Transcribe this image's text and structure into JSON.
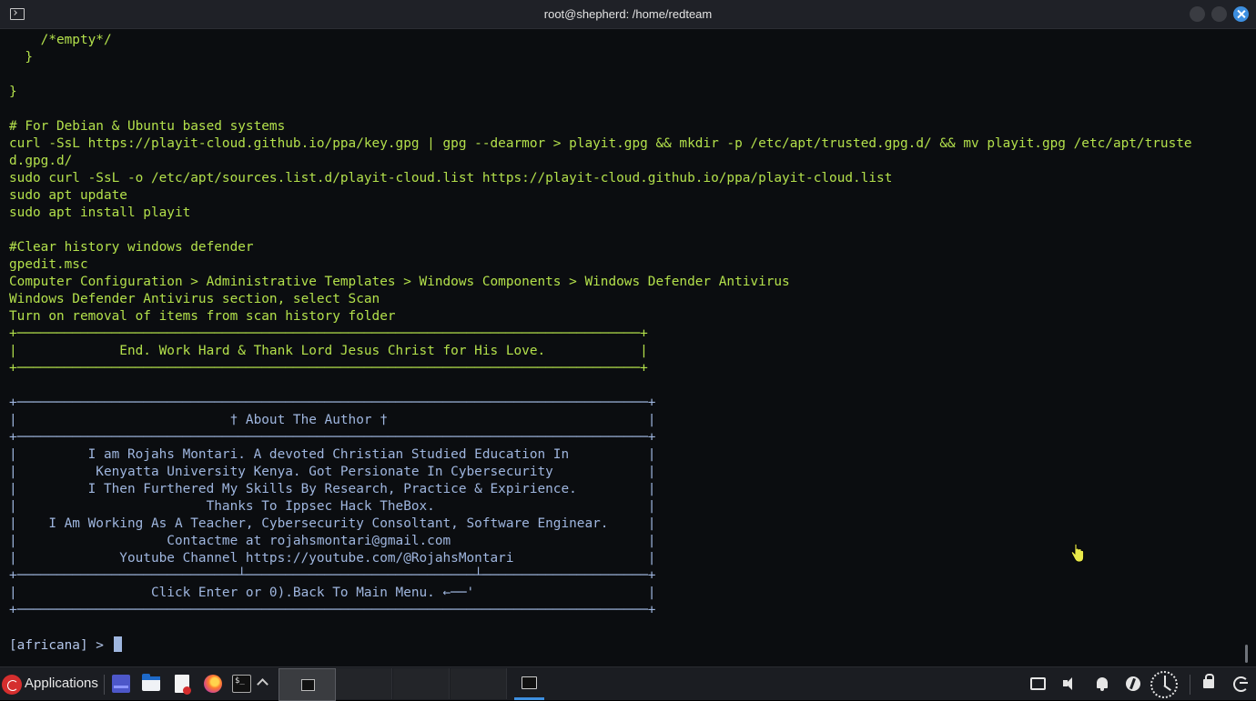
{
  "window": {
    "title": "root@shepherd: /home/redteam"
  },
  "terminal": {
    "lines": [
      {
        "text": "    /*empty*/",
        "color": "green"
      },
      {
        "text": "  }",
        "color": "green"
      },
      {
        "text": "",
        "color": "green"
      },
      {
        "text": "}",
        "color": "green"
      },
      {
        "text": "",
        "color": "green"
      },
      {
        "text": "# For Debian & Ubuntu based systems",
        "color": "green"
      },
      {
        "text": "curl -SsL https://playit-cloud.github.io/ppa/key.gpg | gpg --dearmor > playit.gpg && mkdir -p /etc/apt/trusted.gpg.d/ && mv playit.gpg /etc/apt/truste",
        "color": "green"
      },
      {
        "text": "d.gpg.d/",
        "color": "green"
      },
      {
        "text": "sudo curl -SsL -o /etc/apt/sources.list.d/playit-cloud.list https://playit-cloud.github.io/ppa/playit-cloud.list",
        "color": "green"
      },
      {
        "text": "sudo apt update",
        "color": "green"
      },
      {
        "text": "sudo apt install playit",
        "color": "green"
      },
      {
        "text": "",
        "color": "green"
      },
      {
        "text": "#Clear history windows defender",
        "color": "green"
      },
      {
        "text": "gpedit.msc",
        "color": "green"
      },
      {
        "text": "Computer Configuration > Administrative Templates > Windows Components > Windows Defender Antivirus",
        "color": "green"
      },
      {
        "text": "Windows Defender Antivirus section, select Scan",
        "color": "green"
      },
      {
        "text": "Turn on removal of items from scan history folder",
        "color": "green"
      },
      {
        "text": "+───────────────────────────────────────────────────────────────────────────────+",
        "color": "green"
      },
      {
        "text": "|             End. Work Hard & Thank Lord Jesus Christ for His Love.            |",
        "color": "green"
      },
      {
        "text": "+───────────────────────────────────────────────────────────────────────────────+",
        "color": "green"
      },
      {
        "text": "",
        "color": "blue"
      },
      {
        "text": "+────────────────────────────────────────────────────────────────────────────────+",
        "color": "blue"
      },
      {
        "text": "|                           † About The Author †                                 |",
        "color": "blue"
      },
      {
        "text": "+────────────────────────────────────────────────────────────────────────────────+",
        "color": "blue"
      },
      {
        "text": "|         I am Rojahs Montari. A devoted Christian Studied Education In          |",
        "color": "blue"
      },
      {
        "text": "|          Kenyatta University Kenya. Got Persionate In Cybersecurity            |",
        "color": "blue"
      },
      {
        "text": "|         I Then Furthered My Skills By Research, Practice & Expirience.         |",
        "color": "blue"
      },
      {
        "text": "|                        Thanks To Ippsec Hack TheBox.                           |",
        "color": "blue"
      },
      {
        "text": "|    I Am Working As A Teacher, Cybersecurity Consoltant, Software Enginear.     |",
        "color": "blue"
      },
      {
        "text": "|                   Contactme at rojahsmontari@gmail.com                         |",
        "color": "blue"
      },
      {
        "text": "|             Youtube Channel https://youtube.com/@RojahsMontari                 |",
        "color": "blue"
      },
      {
        "text": "+────────────────────────────┴─────────────────────────────┴─────────────────────+",
        "color": "blue"
      },
      {
        "text": "|                 Click Enter or 0).Back To Main Menu. ←──'                      |",
        "color": "blue"
      },
      {
        "text": "+────────────────────────────────────────────────────────────────────────────────+",
        "color": "blue"
      }
    ],
    "prompt": "[africana] > "
  },
  "taskbar": {
    "applications_label": "Applications"
  },
  "colors": {
    "green_text": "#b3e04b",
    "blue_text": "#9fb6df",
    "terminal_bg": "#0b0d10",
    "accent": "#3d8fe0"
  },
  "icons": {
    "title_icon": "terminal-icon",
    "close": "close-icon",
    "hand_cursor": "pointer-hand-icon"
  }
}
